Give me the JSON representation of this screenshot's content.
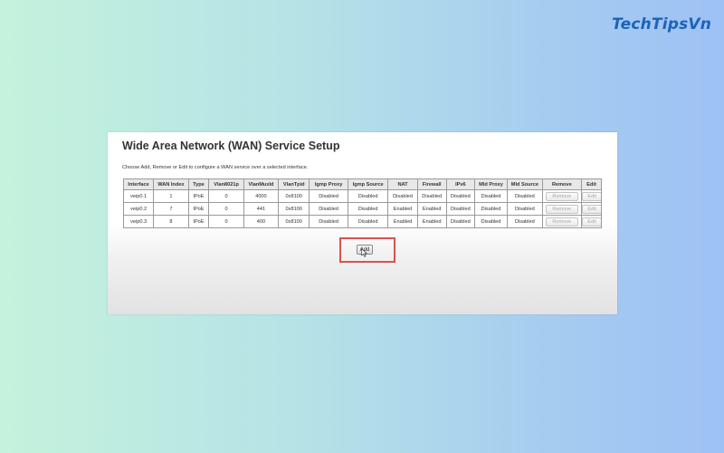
{
  "brand": {
    "logo_text": "TechTipsVn"
  },
  "page": {
    "title": "Wide Area Network (WAN) Service Setup",
    "description": "Choose Add, Remove or Edit to configure a WAN service over a selected interface."
  },
  "table": {
    "headers": [
      "Interface",
      "WAN Index",
      "Type",
      "Vlan8021p",
      "VlanMuxId",
      "VlanTpid",
      "Igmp Proxy",
      "Igmp Source",
      "NAT",
      "Firewall",
      "IPv6",
      "Mld Proxy",
      "Mld Source",
      "Remove",
      "Edit"
    ],
    "rows": [
      [
        "veip0.1",
        "1",
        "IPoE",
        "0",
        "4000",
        "0x8100",
        "Disabled",
        "Disabled",
        "Disabled",
        "Disabled",
        "Disabled",
        "Disabled",
        "Disabled"
      ],
      [
        "veip0.2",
        "7",
        "IPoE",
        "0",
        "441",
        "0x8100",
        "Disabled",
        "Disabled",
        "Enabled",
        "Enabled",
        "Disabled",
        "Disabled",
        "Disabled"
      ],
      [
        "veip0.3",
        "8",
        "IPoE",
        "0",
        "400",
        "0x8100",
        "Disabled",
        "Disabled",
        "Enabled",
        "Enabled",
        "Disabled",
        "Disabled",
        "Disabled"
      ]
    ],
    "remove_label": "Remove",
    "edit_label": "Edit"
  },
  "actions": {
    "add_label": "Add"
  },
  "colors": {
    "highlight": "#d9534f",
    "brand": "#1d63b8"
  }
}
